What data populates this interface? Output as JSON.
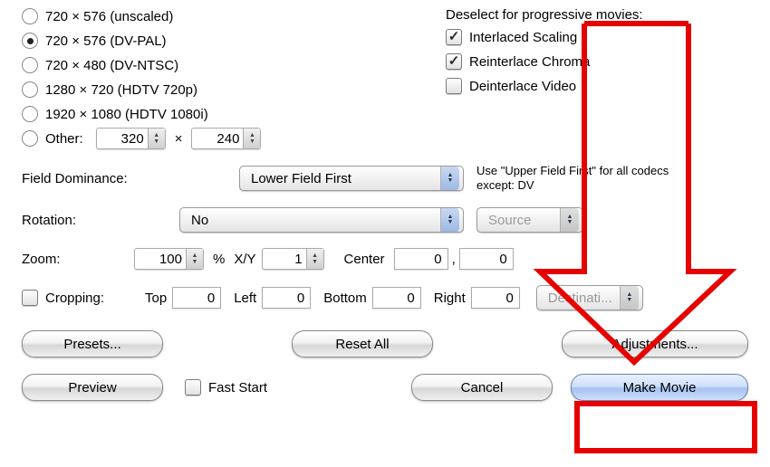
{
  "resolutions": [
    {
      "label": "720 × 576  (unscaled)",
      "selected": false
    },
    {
      "label": "720 × 576  (DV-PAL)",
      "selected": true
    },
    {
      "label": "720 × 480  (DV-NTSC)",
      "selected": false
    },
    {
      "label": "1280 × 720  (HDTV 720p)",
      "selected": false
    },
    {
      "label": "1920 × 1080  (HDTV 1080i)",
      "selected": false
    }
  ],
  "other": {
    "label": "Other:",
    "width": "320",
    "sep": "×",
    "height": "240"
  },
  "progressive": {
    "heading": "Deselect for progressive movies:",
    "interlaced_scaling": {
      "label": "Interlaced Scaling",
      "checked": true
    },
    "reinterlace_chroma": {
      "label": "Reinterlace Chroma",
      "checked": true
    },
    "deinterlace_video": {
      "label": "Deinterlace Video",
      "checked": false
    }
  },
  "field_dominance": {
    "label": "Field Dominance:",
    "value": "Lower Field First",
    "hint": "Use \"Upper Field First\" for all codecs except: DV"
  },
  "rotation": {
    "label": "Rotation:",
    "value": "No",
    "source": "Source"
  },
  "zoom": {
    "label": "Zoom:",
    "value": "100",
    "percent": "%",
    "xy_label": "X/Y",
    "xy_value": "1",
    "center_label": "Center",
    "cx": "0",
    "comma": ",",
    "cy": "0"
  },
  "cropping": {
    "label": "Cropping:",
    "checked": false,
    "top_label": "Top",
    "top": "0",
    "left_label": "Left",
    "left": "0",
    "bottom_label": "Bottom",
    "bottom": "0",
    "right_label": "Right",
    "right": "0",
    "destination": "Destinati..."
  },
  "buttons": {
    "presets": "Presets...",
    "reset_all": "Reset All",
    "adjustments": "Adjustments...",
    "preview": "Preview",
    "fast_start_checked": false,
    "fast_start": "Fast Start",
    "cancel": "Cancel",
    "make_movie": "Make Movie"
  }
}
